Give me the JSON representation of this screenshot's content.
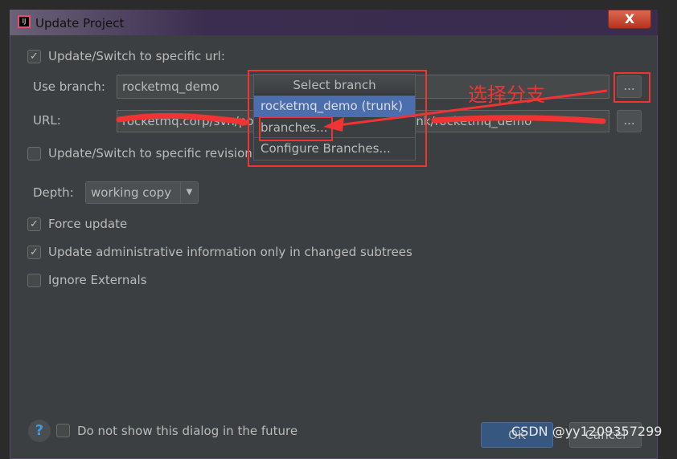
{
  "dialog": {
    "title": "Update Project",
    "close_label": "X"
  },
  "switch_url": {
    "checked": true,
    "label": "Update/Switch to specific url:"
  },
  "branch": {
    "label": "Use branch:",
    "value": "rocketmq_demo",
    "browse_label": "..."
  },
  "url": {
    "label": "URL:",
    "value": "rocketmq.corp/svn/poseidon/rocketmq_demo/trunk/rocketmq_demo",
    "browse_label": "..."
  },
  "popup": {
    "title": "Select branch",
    "items": [
      {
        "label": "rocketmq_demo (trunk)",
        "selected": true
      },
      {
        "label": "branches..."
      },
      {
        "label": "Configure Branches..."
      }
    ]
  },
  "revision": {
    "checked": false,
    "label": "Update/Switch to specific revision"
  },
  "depth": {
    "label": "Depth:",
    "value": "working copy"
  },
  "options": [
    {
      "checked": true,
      "label": "Force update"
    },
    {
      "checked": true,
      "label": "Update administrative information only in changed subtrees"
    },
    {
      "checked": false,
      "label": "Ignore Externals"
    }
  ],
  "footer": {
    "help": "?",
    "dont_show": {
      "checked": false,
      "label": "Do not show this dialog in the future"
    },
    "ok_label": "OK",
    "cancel_label": "Cancel"
  },
  "annotation": {
    "text": "选择分支",
    "color": "#f03333"
  },
  "watermark": "CSDN @yy1209357299",
  "colors": {
    "selection": "#4b6eaf",
    "background": "#3c3f41"
  }
}
